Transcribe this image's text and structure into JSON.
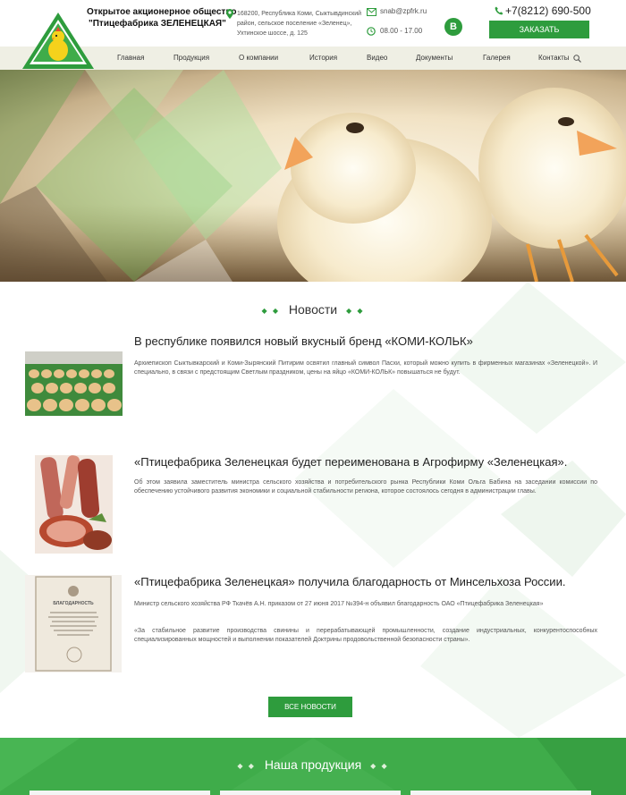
{
  "company": {
    "line1": "Открытое акционерное общество",
    "line2": "\"Птицефабрика ЗЕЛЕНЕЦКАЯ\"",
    "address": "168200, Республика Коми, Сыктывдинский район, сельское поселение «Зеленец», Ухтинское шоссе, д. 125",
    "email": "snab@zpfrk.ru",
    "hours": "08.00 - 17.00",
    "vk_label": "B",
    "phone": "+7(8212) 690-500",
    "order_label": "ЗАКАЗАТЬ"
  },
  "colors": {
    "accent": "#2e9c3d",
    "products_bg": "#3fac4a",
    "nav_bg": "#efefe4"
  },
  "nav": [
    "Главная",
    "Продукция",
    "О компании",
    "История",
    "Видео",
    "Документы",
    "Галерея",
    "Контакты"
  ],
  "news": {
    "title": "Новости",
    "items": [
      {
        "title": "В республике появился новый вкусный бренд «КОМИ-КОЛЬК»",
        "text": "Архиепископ Сыктывкарский и Коми-Зырянский Питирим освятил главный символ Пасхи, который можно купить в фирменных магазинах «Зеленецкой». И специально, в связи с предстоящим Светлым праздником, цены на яйцо «КОМИ-КОЛЬК» повышаться не будут."
      },
      {
        "title": "«Птицефабрика Зеленецкая будет переименована в Агрофирму «Зеленецкая».",
        "text": "Об этом заявила заместитель министра сельского хозяйства и потребительского рынка Республики Коми Ольга Бабина на заседании комиссии по обеспечению устойчивого развития экономики и социальной стабильности региона, которое состоялось сегодня в администрации главы."
      },
      {
        "title": "«Птицефабрика Зеленецкая» получила благодарность от Минсельхоза России.",
        "text": "Министр сельского хозяйства РФ Ткачёв А.Н. приказом от 27 июня 2017 №394-н объявил благодарность ОАО «Птицефабрика Зеленецкая»",
        "text2": "«За стабильное развитие производства свинины и перерабатывающей промышленности, создание индустриальных, конкурентоспособных специализированных мощностей и выполнении показателей Доктрины продовольственной безопасности страны».",
        "cert_heading": "БЛАГОДАРНОСТЬ"
      }
    ],
    "all_label": "ВСЕ НОВОСТИ"
  },
  "products": {
    "title": "Наша продукция"
  },
  "icons": [
    "logo-chick-icon",
    "location-pin-icon",
    "mail-icon",
    "clock-icon",
    "phone-icon",
    "search-icon"
  ]
}
